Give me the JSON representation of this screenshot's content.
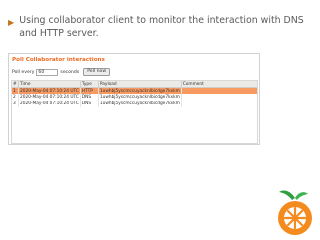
{
  "slide": {
    "bullet_text": "Using collaborator client to monitor the interaction with DNS and HTTP server."
  },
  "collaborator": {
    "panel_title": "Poll Collaborator interactions",
    "poll_every_label": "Poll every",
    "poll_interval_value": "60",
    "seconds_label": "seconds",
    "poll_button_label": "Poll now",
    "table": {
      "headers": [
        "#",
        "Time",
        "Type",
        "Payload",
        "Comment"
      ],
      "rows": [
        {
          "num": "1",
          "time": "2020-May-04 07:10:24 UTC",
          "type": "HTTP",
          "payload": "1uwhbj5yscmccuyacknlbicdge7kxkm",
          "comment": ""
        },
        {
          "num": "2",
          "time": "2020-May-04 07:10:24 UTC",
          "type": "DNS",
          "payload": "1uwhbj5yscmccuyacknlbicdge7kxkm",
          "comment": ""
        },
        {
          "num": "3",
          "time": "2020-May-04 07:10:24 UTC",
          "type": "DNS",
          "payload": "1uwhbj5yscmccuyacknlbicdge7kxkm",
          "comment": ""
        }
      ]
    }
  },
  "colors": {
    "accent": "#f06a1e",
    "selected_row": "#f79a62",
    "bullet": "#c8741e"
  },
  "icons": {
    "bullet": "triangle-bullet-icon",
    "logo": "owasp-logo-icon"
  }
}
